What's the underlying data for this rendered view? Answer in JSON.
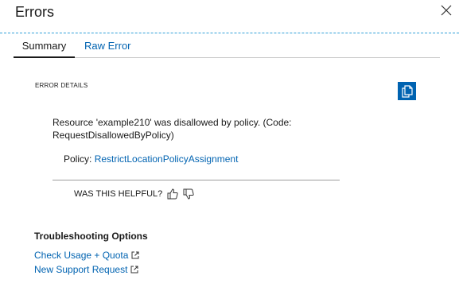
{
  "blade": {
    "title": "Errors",
    "close_icon": "close-icon"
  },
  "tabs": [
    {
      "label": "Summary",
      "active": true
    },
    {
      "label": "Raw Error",
      "active": false
    }
  ],
  "error_details": {
    "label": "ERROR DETAILS",
    "copy_icon": "copy-icon",
    "message": "Resource 'example210' was disallowed by policy. (Code: RequestDisallowedByPolicy)",
    "policy_label": "Policy:",
    "policy_link": "RestrictLocationPolicyAssignment"
  },
  "feedback": {
    "question": "WAS THIS HELPFUL?",
    "thumbs_up_icon": "thumbs-up-icon",
    "thumbs_down_icon": "thumbs-down-icon"
  },
  "troubleshooting": {
    "heading": "Troubleshooting Options",
    "links": [
      {
        "label": "Check Usage + Quota",
        "icon": "external-link-icon"
      },
      {
        "label": "New Support Request",
        "icon": "external-link-icon"
      }
    ]
  },
  "colors": {
    "accent": "#0063b1",
    "header_border": "#2f9fd8"
  }
}
